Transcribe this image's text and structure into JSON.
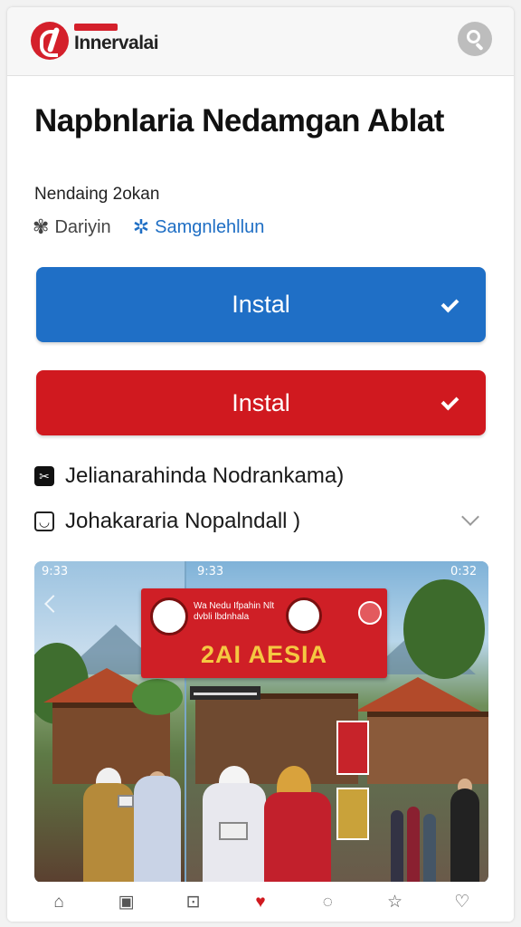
{
  "header": {
    "brand": "Innervalai",
    "brand_color": "#d4202b",
    "search_icon": "search-icon"
  },
  "app": {
    "title": "Napbnlaria Nedamgan Ablat",
    "subtitle": "Nendaing 2okan",
    "developer": "Dariyin",
    "category": "Samgnlehllun"
  },
  "actions": {
    "primary_label": "Instal",
    "primary_color": "#1f6fc6",
    "secondary_label": "Instal",
    "secondary_color": "#d0191f"
  },
  "info_rows": [
    {
      "label": "Jelianarahinda Nodrankama)",
      "icon": "tools-icon"
    },
    {
      "label": "Johakararia Nopalndall )",
      "icon": "box-icon"
    }
  ],
  "gallery": {
    "status_left": "9:33",
    "status_mid": "9:33",
    "status_right": "0:32",
    "banner_small": "Wa Nedu Ifpahin Nlt dvbli lbdnhala",
    "banner_main": "2AI AESIA"
  },
  "bottom_nav": [
    {
      "name": "home-icon",
      "glyph": "⌂"
    },
    {
      "name": "calendar-icon",
      "glyph": "▣"
    },
    {
      "name": "book-icon",
      "glyph": "⊡"
    },
    {
      "name": "heart-icon",
      "glyph": "♥",
      "active": true
    },
    {
      "name": "chat-icon",
      "glyph": "◌"
    },
    {
      "name": "star-icon",
      "glyph": "☆"
    },
    {
      "name": "favorite-icon",
      "glyph": "♡"
    }
  ]
}
